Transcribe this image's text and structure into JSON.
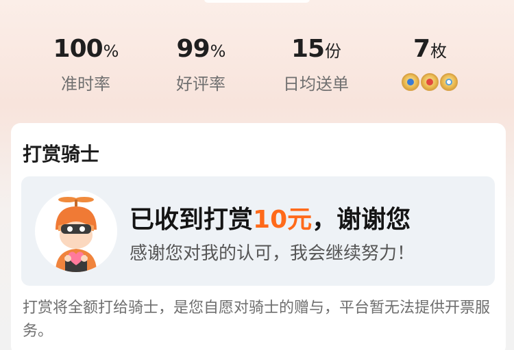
{
  "stats": [
    {
      "value": "100",
      "unit": "%",
      "label": "准时率"
    },
    {
      "value": "99",
      "unit": "%",
      "label": "好评率"
    },
    {
      "value": "15",
      "unit": "份",
      "label": "日均送单"
    },
    {
      "value": "7",
      "unit": "枚",
      "label": ""
    }
  ],
  "badges": [
    "police-badge-icon",
    "medal-badge-icon",
    "clock-badge-icon"
  ],
  "tip_card": {
    "title": "打赏骑士",
    "main_prefix": "已收到打赏",
    "amount": "10元",
    "main_suffix": "，谢谢您",
    "sub": "感谢您对我的认可，我会继续努力！",
    "note": "打赏将全额打给骑士，是您自愿对骑士的赠与，平台暂无法提供开票服务。"
  },
  "colors": {
    "accent": "#ff6a1a",
    "card_bg": "#ffffff",
    "box_bg": "#eef2f6"
  }
}
